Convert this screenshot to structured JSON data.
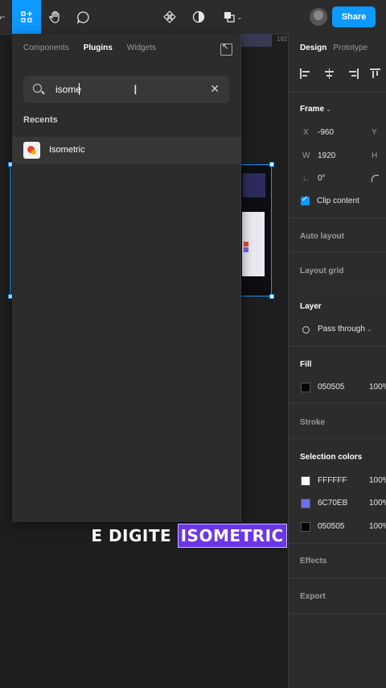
{
  "toolbar": {
    "share_label": "Share",
    "icons": [
      "plugin-grid-icon",
      "hand-icon",
      "comment-icon",
      "component-icon",
      "contrast-icon",
      "multiplayer-icon",
      "chevron-down-icon"
    ]
  },
  "canvas": {
    "ruler_label": "192"
  },
  "plugin_panel": {
    "tabs": [
      {
        "label": "Components",
        "active": false
      },
      {
        "label": "Plugins",
        "active": true
      },
      {
        "label": "Widgets",
        "active": false
      }
    ],
    "search_value": "isome",
    "recents_heading": "Recents",
    "plugins": [
      {
        "name": "Isometric"
      }
    ]
  },
  "design_panel": {
    "tabs": [
      {
        "label": "Design",
        "active": true
      },
      {
        "label": "Prototype",
        "active": false
      }
    ],
    "frame": {
      "heading": "Frame",
      "x_label": "X",
      "x_value": "-960",
      "y_label": "Y",
      "w_label": "W",
      "w_value": "1920",
      "h_label": "H",
      "rotation_value": "0°",
      "clip_content_label": "Clip content"
    },
    "auto_layout": "Auto layout",
    "layout_grid": "Layout grid",
    "layer": {
      "heading": "Layer",
      "blend": "Pass through"
    },
    "fill": {
      "heading": "Fill",
      "hex": "050505",
      "pct": "100%"
    },
    "stroke": "Stroke",
    "selection_colors": {
      "heading": "Selection colors",
      "items": [
        {
          "hex": "FFFFFF",
          "color": "#ffffff",
          "pct": "100%"
        },
        {
          "hex": "6C70EB",
          "color": "#6c70eb",
          "pct": "100%"
        },
        {
          "hex": "050505",
          "color": "#050505",
          "pct": "100%"
        }
      ]
    },
    "effects": "Effects",
    "export": "Export"
  },
  "caption": {
    "lead": "E DIGITE ",
    "highlight": "ISOMETRIC"
  },
  "colors": {
    "accent": "#0d99ff",
    "caption_highlight": "#6c35e8"
  }
}
